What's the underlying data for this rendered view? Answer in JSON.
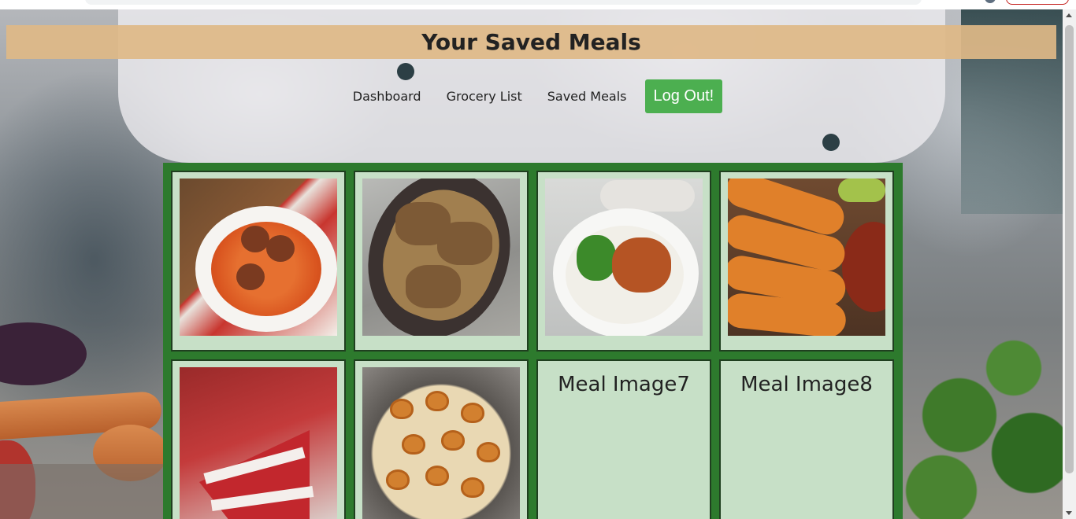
{
  "page": {
    "title": "Your Saved Meals"
  },
  "nav": {
    "items": [
      {
        "id": "dashboard",
        "label": "Dashboard"
      },
      {
        "id": "grocery-list",
        "label": "Grocery List"
      },
      {
        "id": "saved-meals",
        "label": "Saved Meals"
      }
    ],
    "logout_label": "Log Out!"
  },
  "meals": [
    {
      "slot": 1,
      "image": "spaghetti-meatballs",
      "alt_label": ""
    },
    {
      "slot": 2,
      "image": "smothered-pork-chops",
      "alt_label": ""
    },
    {
      "slot": 3,
      "image": "teriyaki-chicken-bowl",
      "alt_label": ""
    },
    {
      "slot": 4,
      "image": "birria-tacos",
      "alt_label": ""
    },
    {
      "slot": 5,
      "image": "red-velvet-cake",
      "alt_label": ""
    },
    {
      "slot": 6,
      "image": "cajun-shrimp-pasta",
      "alt_label": ""
    },
    {
      "slot": 7,
      "image": "",
      "alt_label": "Meal Image7"
    },
    {
      "slot": 8,
      "image": "",
      "alt_label": "Meal Image8"
    }
  ],
  "colors": {
    "header_bar": "#deb887",
    "logout_button": "#4caf50",
    "grid_background": "#2d7a2d",
    "card_background": "#ddeedd"
  }
}
